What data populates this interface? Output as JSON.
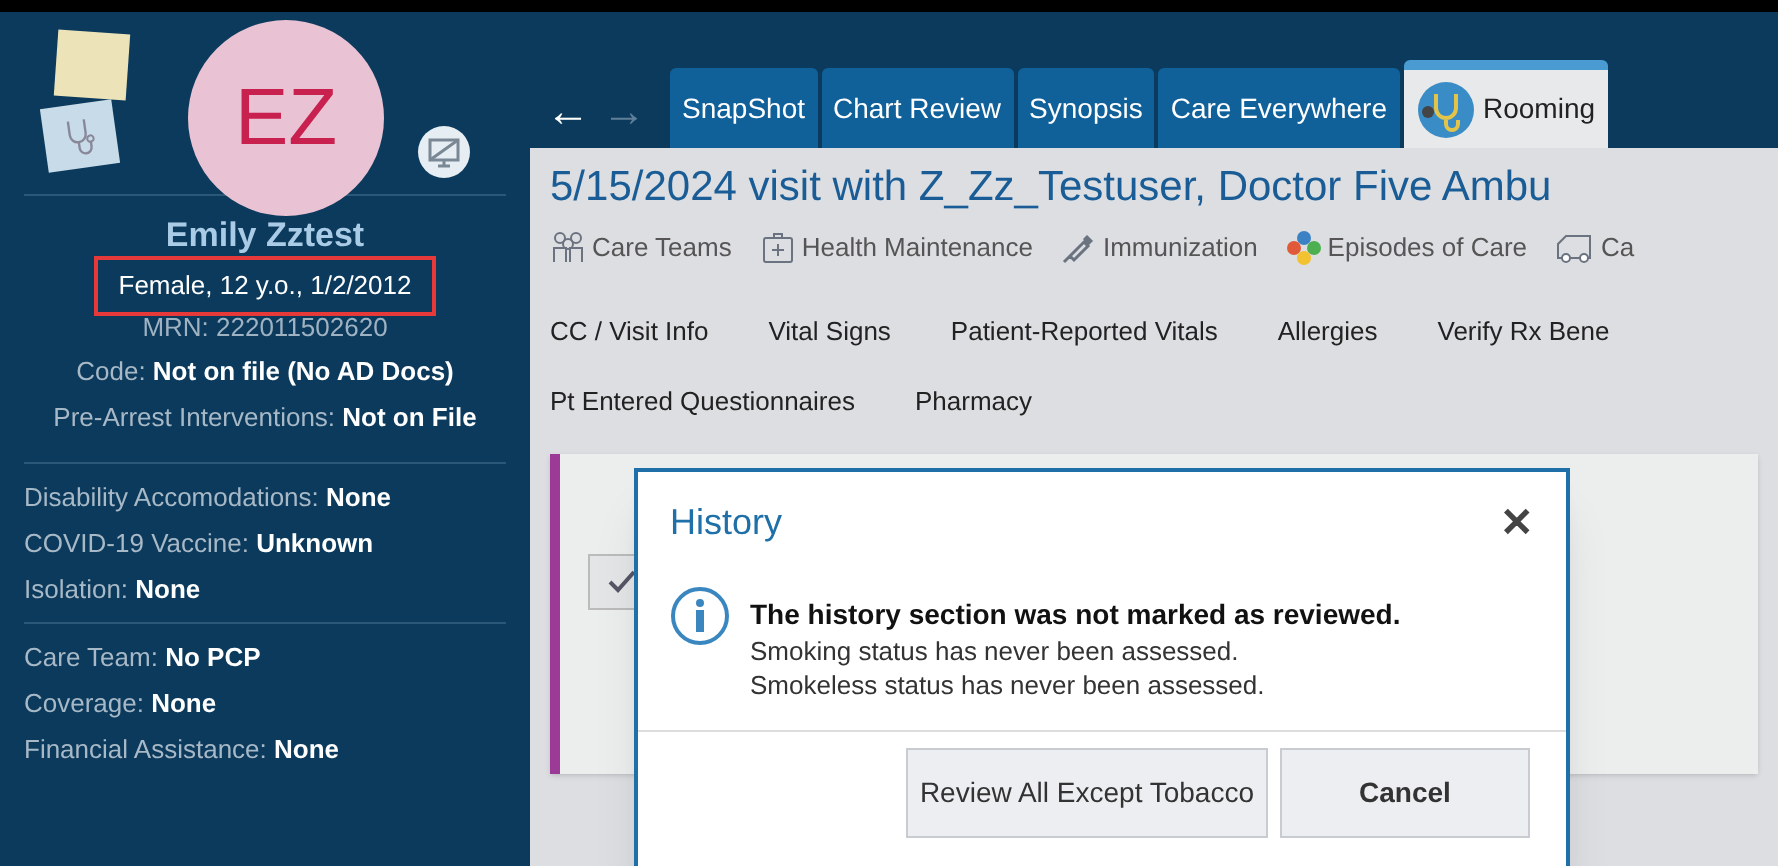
{
  "patient": {
    "initials": "EZ",
    "name": "Emily Zztest",
    "demographics": {
      "text": "Female, 12 y.o., 1/2/2012",
      "highlighted": true
    },
    "mrn": "MRN: 222011502620",
    "sections": [
      [
        {
          "text": "Code: **Not on file (No AD Docs)**"
        },
        {
          "text": "Pre-Arrest Interventions: **Not on File**"
        }
      ],
      [
        {
          "text": "Disability Accomodations: **None**"
        },
        {
          "text": "COVID-19 Vaccine: **Unknown**"
        },
        {
          "text": "Isolation: **None**"
        }
      ],
      [
        {
          "text": "Care Team: **No PCP**"
        },
        {
          "text": "Coverage: **None**"
        },
        {
          "text": "Financial Assistance: **None**"
        }
      ]
    ]
  },
  "nav": {
    "back": "←",
    "forward": "→"
  },
  "tabs": [
    {
      "label": "SnapShot",
      "selected": false
    },
    {
      "label": "Chart Review",
      "selected": false
    },
    {
      "label": "Synopsis",
      "selected": false
    },
    {
      "label": "Care Everywhere",
      "selected": false
    },
    {
      "label": "Rooming",
      "selected": true
    }
  ],
  "visit_title": "5/15/2024 visit with Z_Zz_Testuser, Doctor Five Ambu",
  "toolbar": [
    {
      "kind": "team",
      "label": "Care Teams"
    },
    {
      "kind": "kit",
      "label": "Health Maintenance"
    },
    {
      "kind": "syringe",
      "label": "Immunization"
    },
    {
      "kind": "dots",
      "label": "Episodes of Care"
    },
    {
      "kind": "vehicle",
      "label": "Ca"
    }
  ],
  "sections_nav": [
    [
      "CC / Visit Info",
      "Vital Signs",
      "Patient-Reported Vitals",
      "Allergies",
      "Verify Rx Bene"
    ],
    [
      "Pt Entered Questionnaires",
      "Pharmacy"
    ]
  ],
  "dialog": {
    "title": "History",
    "close": "✕",
    "heading": "The history section was not marked as reviewed.",
    "lines": [
      "Smoking status has never been assessed.",
      "Smokeless status has never been assessed."
    ],
    "buttons": [
      {
        "label": "Review All Except Tobacco",
        "primary": false
      },
      {
        "label": "Cancel",
        "primary": true
      }
    ]
  }
}
